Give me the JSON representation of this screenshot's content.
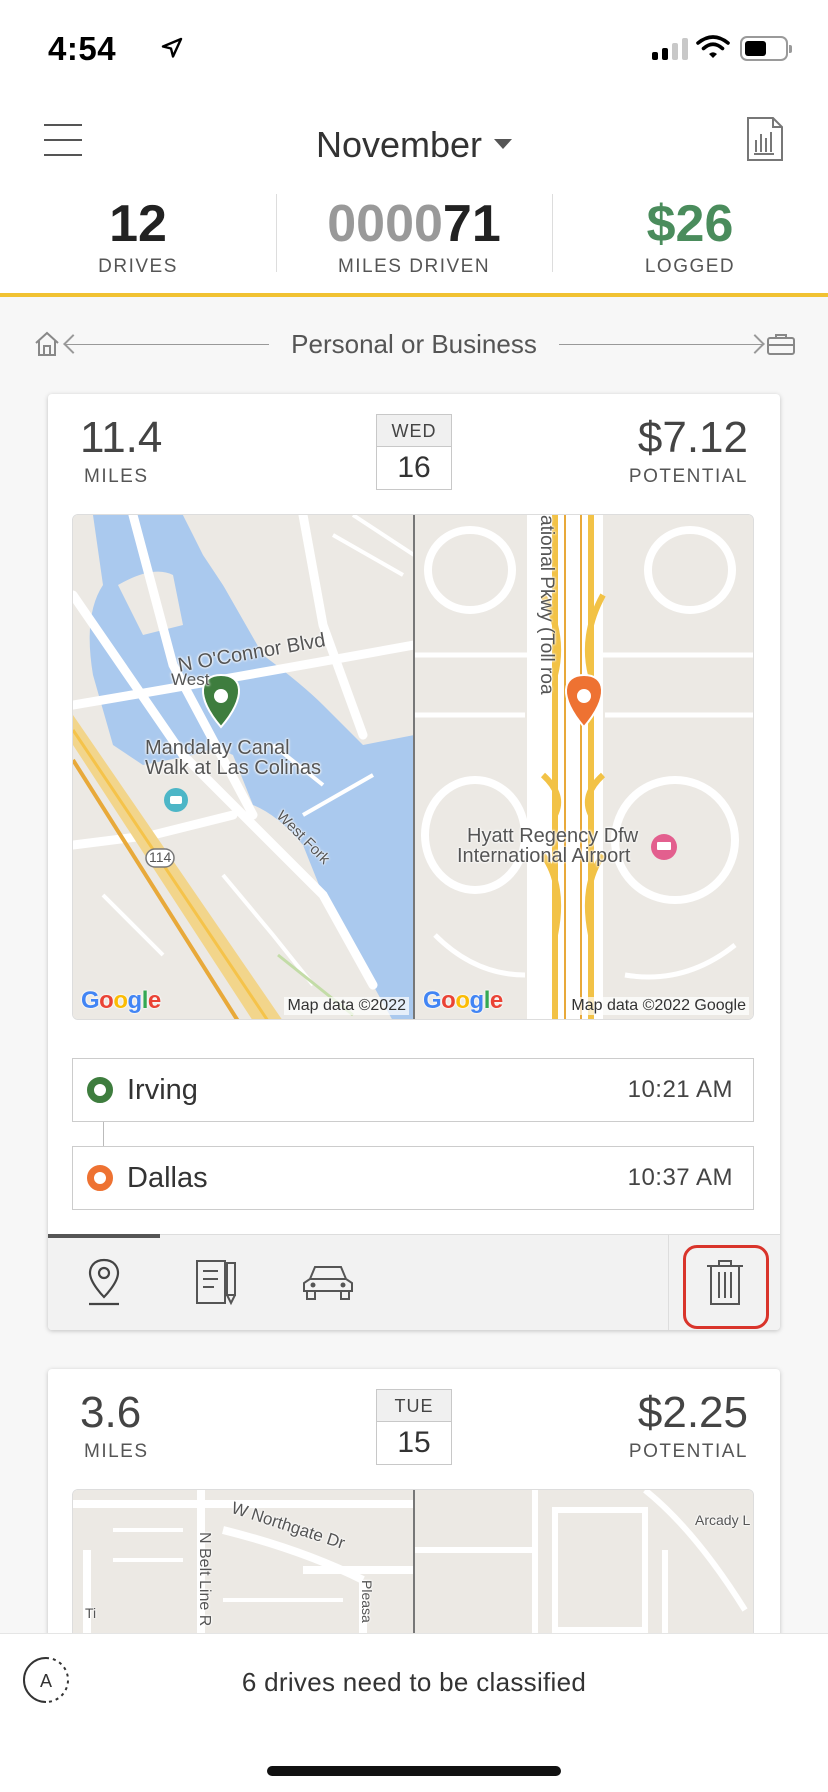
{
  "status_bar": {
    "time": "4:54"
  },
  "header": {
    "month": "November",
    "stats": [
      {
        "value_faded": "",
        "value_main": "12",
        "label": "DRIVES"
      },
      {
        "value_faded": "0000",
        "value_main": "71",
        "label": "MILES DRIVEN"
      },
      {
        "value_faded": "",
        "value_main": "$26",
        "label": "LOGGED"
      }
    ]
  },
  "classify_bar": {
    "label": "Personal or Business"
  },
  "drives": [
    {
      "miles": "11.4",
      "miles_label": "MILES",
      "day_of_week": "WED",
      "day": "16",
      "potential": "$7.12",
      "potential_label": "POTENTIAL",
      "map_start": {
        "labels": [
          "N O'Connor Blvd",
          "West",
          "Mandalay Canal",
          "Walk at Las Colinas",
          "West Fork",
          "114"
        ],
        "attribution": "Map data ©2022"
      },
      "map_end": {
        "labels": [
          "ational Pkwy (Toll roa",
          "Hyatt Regency Dfw",
          "International Airport"
        ],
        "attribution": "Map data ©2022 Google"
      },
      "start": {
        "place": "Irving",
        "time": "10:21 AM"
      },
      "end": {
        "place": "Dallas",
        "time": "10:37 AM"
      }
    },
    {
      "miles": "3.6",
      "miles_label": "MILES",
      "day_of_week": "TUE",
      "day": "15",
      "potential": "$2.25",
      "potential_label": "POTENTIAL",
      "map_start": {
        "labels": [
          "W Northgate Dr",
          "N Belt Line R",
          "Pleasa",
          "Ti"
        ]
      },
      "map_end": {
        "labels": [
          "Arcady L"
        ]
      }
    }
  ],
  "google_logo": "Google",
  "bottom_bar": {
    "auto_badge": "A",
    "message": "6 drives need to be classified"
  },
  "colors": {
    "accent_yellow": "#f1c232",
    "logged_green": "#4a8c5c",
    "start_pin": "#3e7d3e",
    "end_pin": "#ee7232",
    "highlight_red": "#d9342b"
  }
}
